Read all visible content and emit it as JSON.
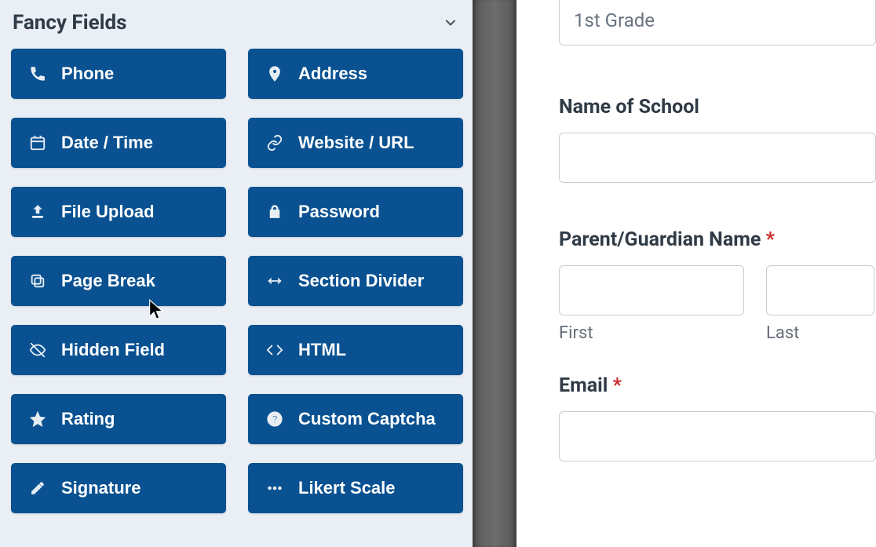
{
  "sidebar": {
    "title": "Fancy Fields",
    "fields": [
      {
        "label": "Phone"
      },
      {
        "label": "Address"
      },
      {
        "label": "Date / Time"
      },
      {
        "label": "Website / URL"
      },
      {
        "label": "File Upload"
      },
      {
        "label": "Password"
      },
      {
        "label": "Page Break"
      },
      {
        "label": "Section Divider"
      },
      {
        "label": "Hidden Field"
      },
      {
        "label": "HTML"
      },
      {
        "label": "Rating"
      },
      {
        "label": "Custom Captcha"
      },
      {
        "label": "Signature"
      },
      {
        "label": "Likert Scale"
      }
    ]
  },
  "form": {
    "grade_value": "1st Grade",
    "school_label": "Name of School",
    "school_value": "",
    "parent_label": "Parent/Guardian Name",
    "required_marker": "*",
    "first_label": "First",
    "last_label": "Last",
    "email_label": "Email"
  }
}
